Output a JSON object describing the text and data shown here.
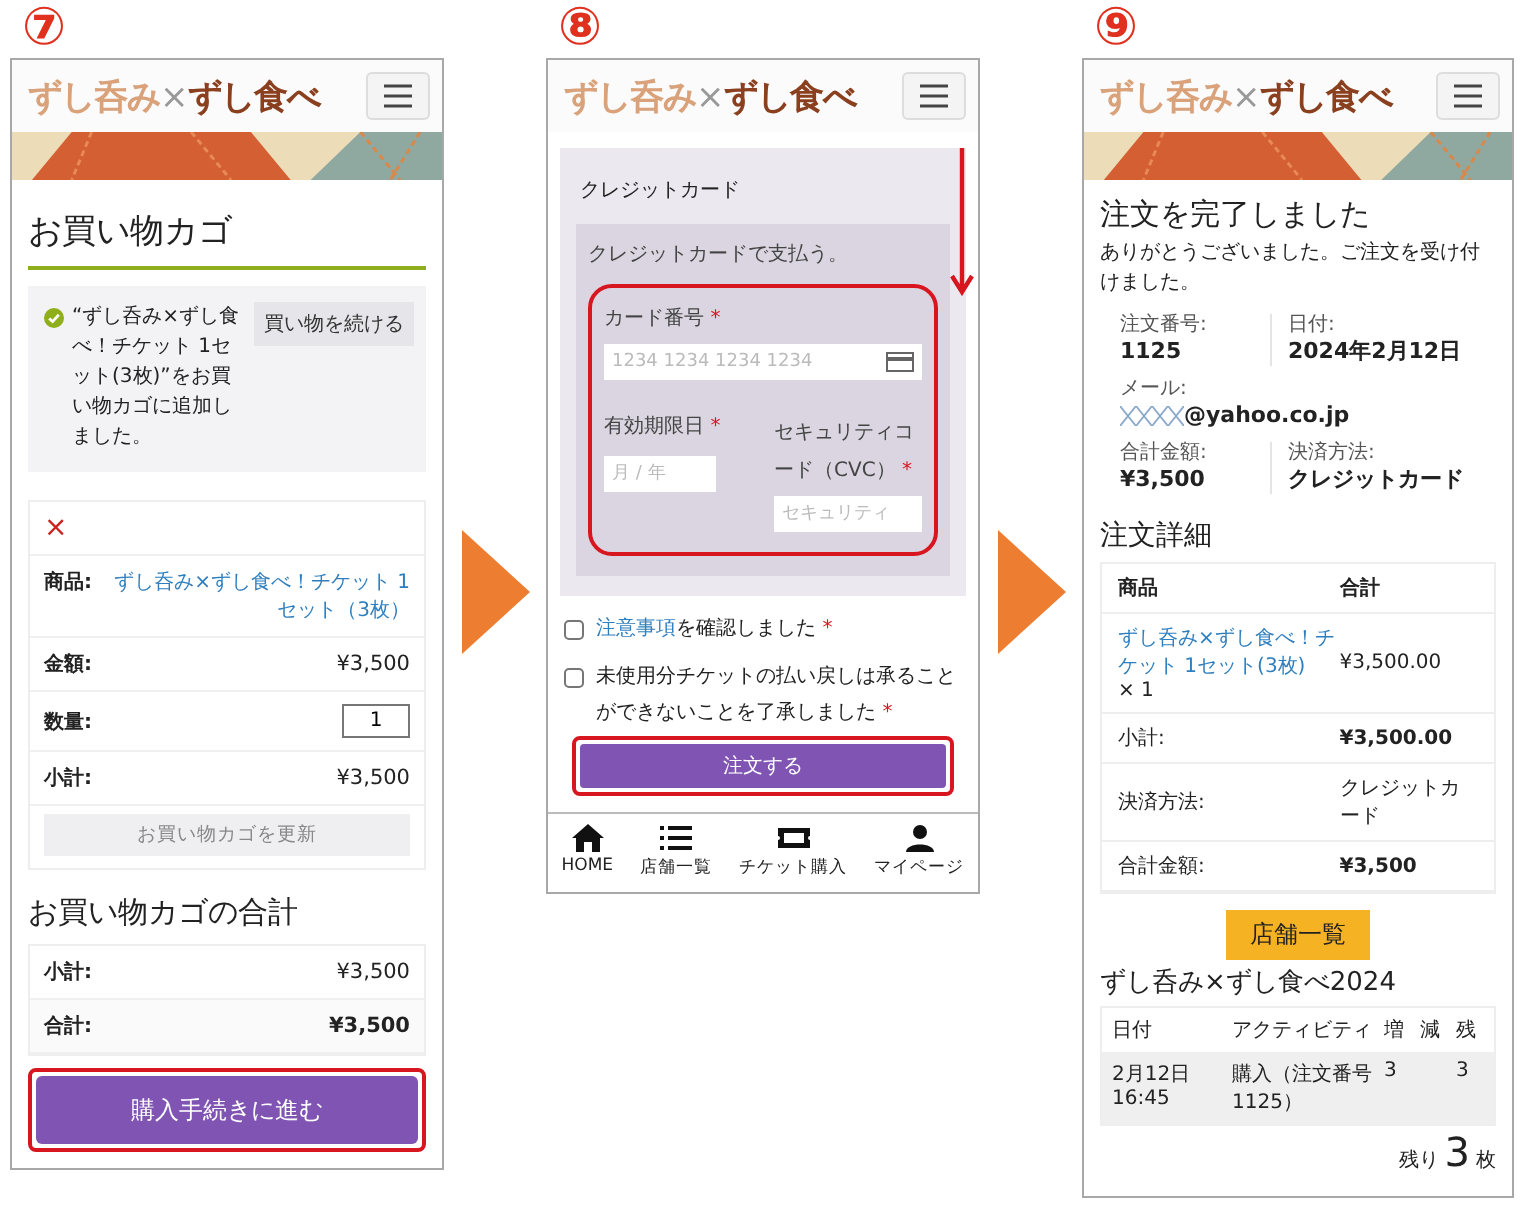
{
  "cart_screen": {
    "step": "⑦",
    "logo": {
      "part_1": "ずし呑み",
      "separator": "×",
      "part_2": "ずし食べ"
    },
    "title": "お買い物カゴ",
    "notice": {
      "text": "“ずし呑み×ずし食べ！チケット 1セット(3枚)”をお買い物カゴに追加しました。",
      "button": "買い物を続ける"
    },
    "item": {
      "remove": "×",
      "rows": [
        {
          "label": "商品:",
          "value": "ずし呑み×ずし食べ！チケット 1セット（3枚）",
          "kind": "link"
        },
        {
          "label": "金額:",
          "value": "¥3,500",
          "kind": "text"
        },
        {
          "label": "数量:",
          "value": "1",
          "kind": "input"
        },
        {
          "label": "小計:",
          "value": "¥3,500",
          "kind": "text"
        }
      ],
      "update_button": "お買い物カゴを更新"
    },
    "totals": {
      "title": "お買い物カゴの合計",
      "rows": [
        {
          "label": "小計:",
          "value": "¥3,500",
          "bold": false
        },
        {
          "label": "合計:",
          "value": "¥3,500",
          "bold": true
        }
      ]
    },
    "checkout_button": {
      "label": "購入手続きに進む",
      "highlighted": true
    }
  },
  "payment_screen": {
    "step": "⑧",
    "logo": {
      "part_1": "ずし呑み",
      "separator": "×",
      "part_2": "ずし食べ"
    },
    "method_tab": "クレジットカード",
    "description": "クレジットカードで支払う。",
    "required_mark": "*",
    "card_fields": {
      "highlighted": true,
      "card_number": {
        "label": "カード番号",
        "placeholder": "1234 1234 1234 1234",
        "required": true
      },
      "expiry": {
        "label": "有効期限日",
        "placeholder": "月 / 年",
        "required": true
      },
      "cvc": {
        "label": "セキュリティコード（CVC）",
        "placeholder": "セキュリティ",
        "required": true
      }
    },
    "agreements": [
      {
        "link": "注意事項",
        "text": "を確認しました",
        "checked": false,
        "required": true
      },
      {
        "text": "未使用分チケットの払い戻しは承ることができないことを了承しました",
        "checked": false,
        "required": true
      }
    ],
    "order_button": {
      "label": "注文する",
      "highlighted": true
    },
    "bottom_nav": [
      {
        "label": "HOME",
        "kind": "home"
      },
      {
        "label": "店舗一覧",
        "kind": "list"
      },
      {
        "label": "チケット購入",
        "kind": "ticket"
      },
      {
        "label": "マイページ",
        "kind": "user"
      }
    ]
  },
  "complete_screen": {
    "step": "⑨",
    "logo": {
      "part_1": "ずし呑み",
      "separator": "×",
      "part_2": "ずし食べ"
    },
    "title": "注文を完了しました",
    "message": "ありがとうございました。ご注文を受け付けました。",
    "overview": [
      {
        "label": "注文番号:",
        "value": "1125",
        "kind": "plain"
      },
      {
        "label": "日付:",
        "value": "2024年2月12日",
        "kind": "plain"
      },
      {
        "label": "メール:",
        "value": "@yahoo.co.jp",
        "kind": "masked"
      },
      {
        "label": "合計金額:",
        "value": "¥3,500",
        "kind": "plain"
      },
      {
        "label": "決済方法:",
        "value": "クレジットカード",
        "kind": "plain"
      }
    ],
    "details_title": "注文詳細",
    "details_columns": [
      "商品",
      "合計"
    ],
    "details_item": {
      "product": "ずし呑み×ずし食べ！チケット 1セット(3枚)",
      "quantity": "× 1",
      "total": "¥3,500.00"
    },
    "details_summary": [
      {
        "label": "小計:",
        "value": "¥3,500.00"
      },
      {
        "label": "決済方法:",
        "value": "クレジットカード"
      },
      {
        "label": "合計金額:",
        "value": "¥3,500"
      }
    ],
    "shops_button": "店舗一覧",
    "ticket_title": "ずし呑み×ずし食べ2024",
    "history_columns": [
      "日付",
      "アクティビティ",
      "増",
      "減",
      "残"
    ],
    "history_rows": [
      {
        "date": "2月12日 16:45",
        "activity": "購入（注文番号1125）",
        "increase": "3",
        "balance": "3"
      }
    ],
    "remaining": {
      "prefix": "残り",
      "count": "3",
      "unit": "枚"
    }
  }
}
